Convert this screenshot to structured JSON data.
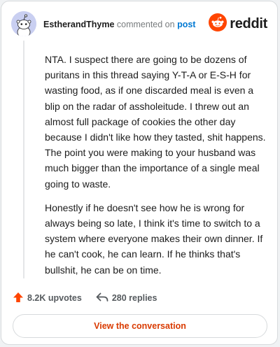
{
  "comment": {
    "username": "EstherandThyme",
    "action_text": "commented on",
    "post_link_text": "post",
    "paragraphs": [
      "NTA. I suspect there are going to be dozens of puritans in this thread saying Y-T-A or E-S-H for wasting food, as if one discarded meal is even a blip on the radar of assholeitude. I threw out an almost full package of cookies the other day because I didn't like how they tasted, shit happens. The point you were making to your husband was much bigger than the importance of a single meal going to waste.",
      "Honestly if he doesn't see how he is wrong for always being so late, I think it's time to switch to a system where everyone makes their own dinner. If he can't cook, he can learn. If he thinks that's bullshit, he can be on time."
    ],
    "upvotes_label": "8.2K upvotes",
    "replies_label": "280 replies"
  },
  "brand": {
    "wordmark": "reddit",
    "icon": "reddit-logo-icon",
    "color": "#ff4500"
  },
  "footer": {
    "view_conversation_label": "View the conversation"
  },
  "colors": {
    "accent_link": "#0079d3",
    "upvote": "#ff4500",
    "button_text": "#d93a00",
    "avatar_bg": "#c9cff1"
  },
  "icons": {
    "avatar": "snoo-avatar-icon",
    "upvote": "upvote-arrow-icon",
    "reply": "reply-arrow-icon"
  }
}
